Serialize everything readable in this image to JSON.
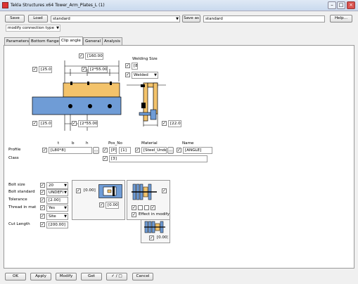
{
  "window": {
    "title": "Tekla Structures x64  Tower_Arm_Plates_L (1)"
  },
  "toolbar": {
    "save": "Save",
    "load": "Load",
    "load_value": "standard",
    "save_as": "Save as",
    "save_as_value": "standard",
    "help": "Help...",
    "mode": "modify connection type"
  },
  "tabs": [
    "Parameters",
    "Bottom flange",
    "Clip angle",
    "General",
    "Analysis"
  ],
  "drawing": {
    "top": "[160.00]",
    "left_top": "[25.00]",
    "mid_top": "[2*55.00]",
    "left_bot": "[25.00]",
    "mid_bot": "[2*55.00]",
    "welding_size_label": "Welding Size",
    "weld_size": "[8]",
    "weld_type": "Welded",
    "right_bot": "[22.00]"
  },
  "profile": {
    "hdr_t": "t",
    "hdr_b": "b",
    "hdr_h": "h",
    "hdr_pos": "Pos_No",
    "hdr_material": "Material",
    "hdr_name": "Name",
    "profile_label": "Profile",
    "profile_value": "[L80*8]",
    "pos_prefix": "[P]",
    "pos_num": "[1]",
    "material": "[Steel_Undefi",
    "dots": "...",
    "name": "[ANGLE]",
    "class_label": "Class",
    "class_value": "[3]"
  },
  "bolts": {
    "size_label": "Bolt size",
    "size_value": "20",
    "standard_label": "Bolt standard",
    "standard_value": "UNDEFI",
    "tolerance_label": "Tolerance",
    "tolerance_value": "[2.00]",
    "thread_label": "Thread in mat",
    "thread_value": "Yes",
    "site_value": "Site",
    "cut_label": "Cut Length",
    "cut_value": "[200.00]"
  },
  "panels": {
    "p1_value": "[0.00]",
    "p1_value2": "[0.00]",
    "effect_label": "Effect in modify",
    "p3_value": "[0.00]"
  },
  "footer": {
    "ok": "OK",
    "apply": "Apply",
    "modify": "Modify",
    "get": "Get",
    "toggle": "✓ / □",
    "cancel": "Cancel"
  },
  "check": "✓"
}
